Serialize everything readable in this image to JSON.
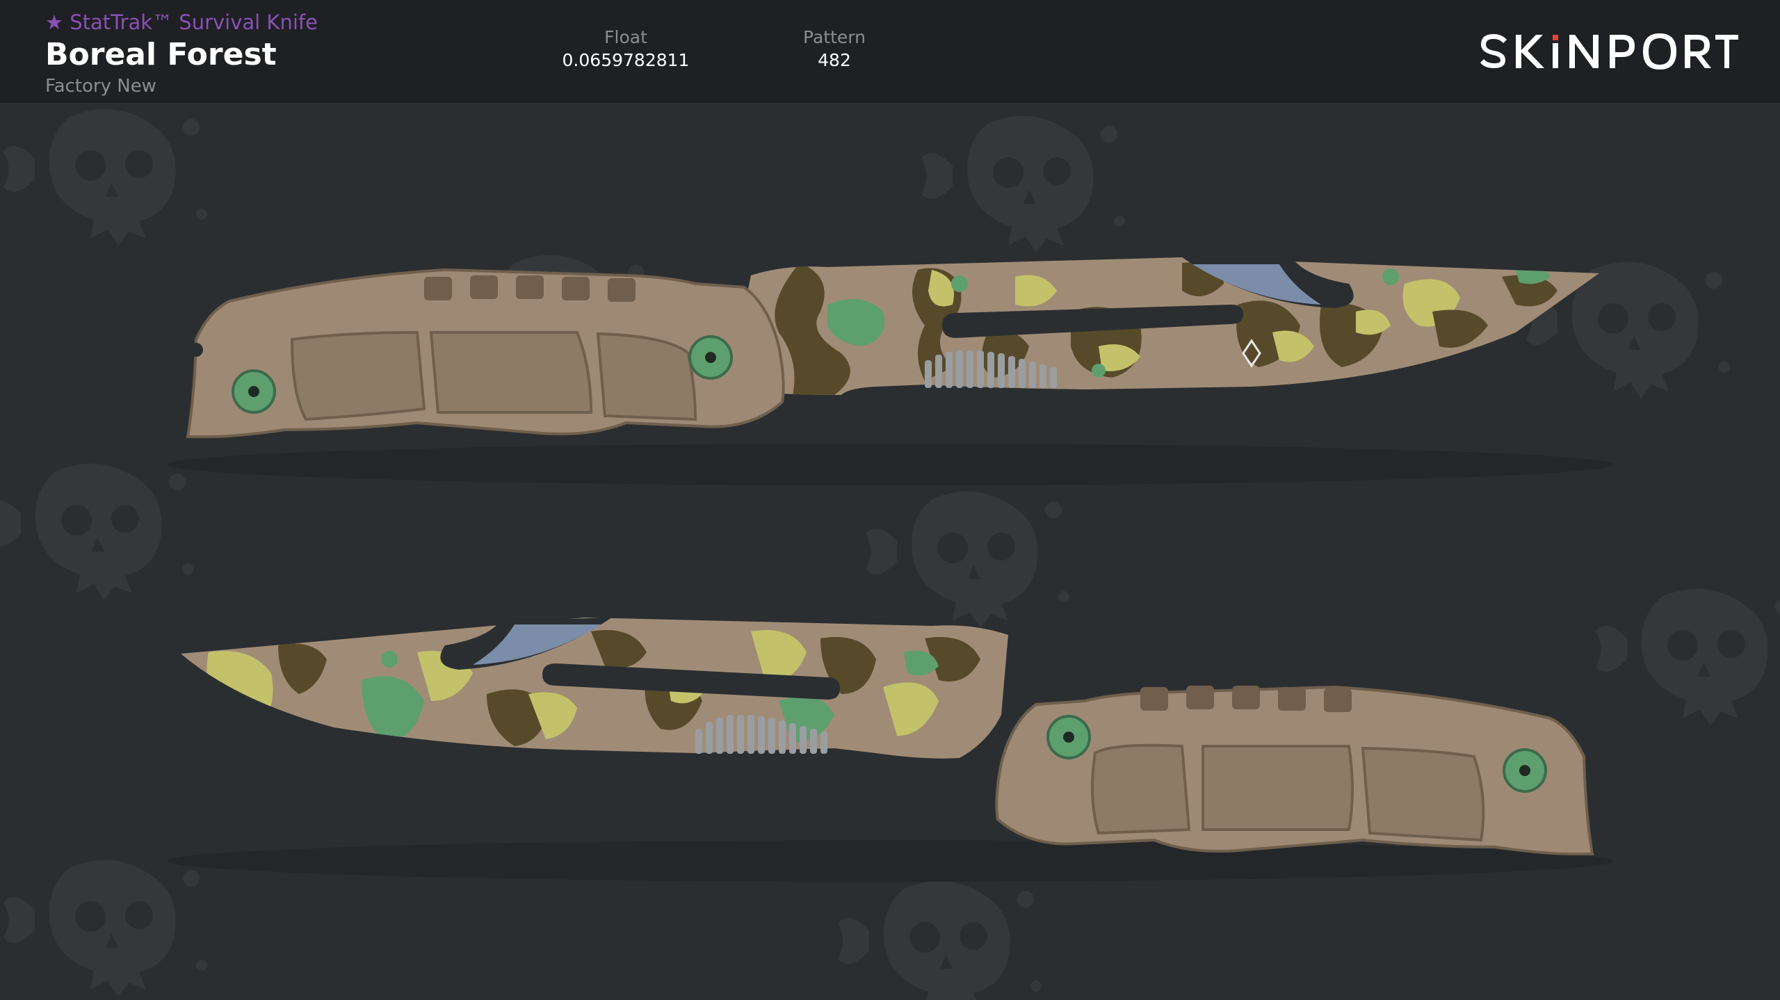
{
  "item": {
    "type": "★ StatTrak™ Survival Knife",
    "name": "Boreal Forest",
    "wear": "Factory New"
  },
  "stats": {
    "float_label": "Float",
    "float_value": "0.0659782811",
    "pattern_label": "Pattern",
    "pattern_value": "482"
  },
  "brand": {
    "logo_text": "SKINPORT",
    "accent": "#e4442f"
  },
  "colors": {
    "header_bg": "#1e2023",
    "canvas_bg": "#2b2e31",
    "type_text": "#8a50b8",
    "handle": "#9e8a74",
    "camo_tan": "#a08c76",
    "camo_brown": "#574a2a",
    "camo_yellow": "#c3c26a",
    "camo_green": "#5e9f6e",
    "screw": "#5e9f6e"
  },
  "icons": {
    "watermark": "piranha-skull-icon",
    "star": "star-icon"
  }
}
